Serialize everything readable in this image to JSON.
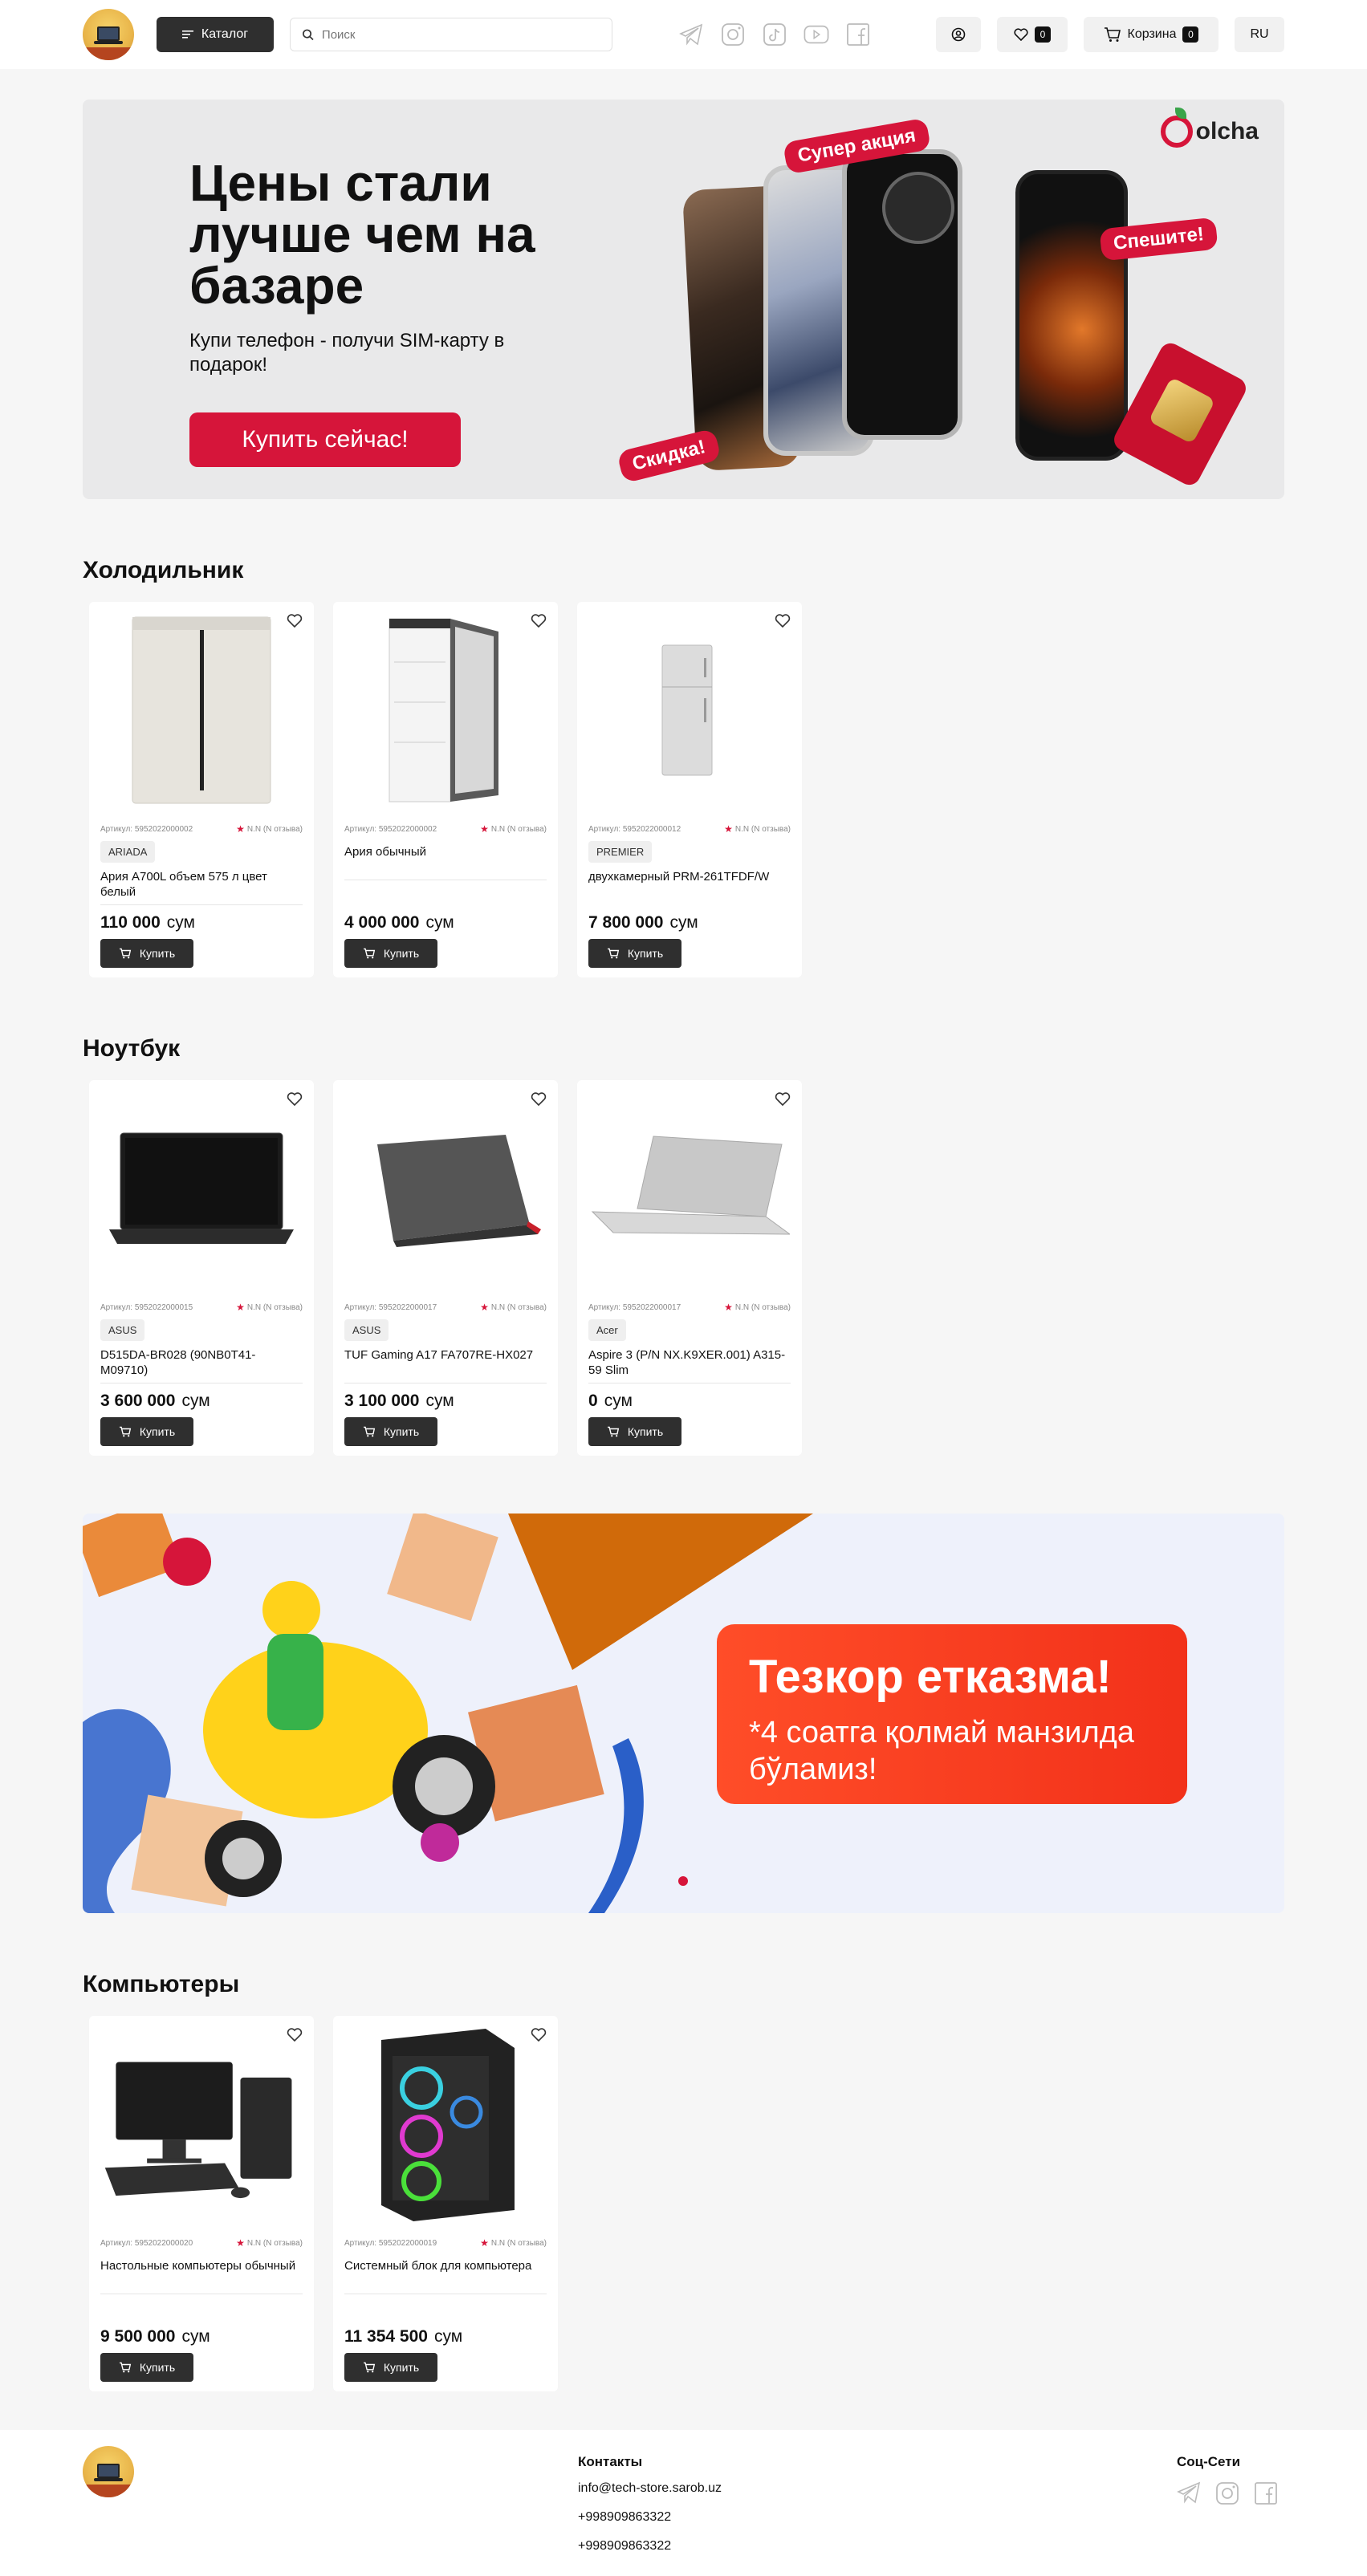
{
  "header": {
    "catalog_label": "Каталог",
    "search_placeholder": "Поиск",
    "wishlist_count": "0",
    "cart_label": "Корзина",
    "cart_count": "0",
    "language": "RU",
    "social_icons": [
      "telegram-icon",
      "instagram-icon",
      "tiktok-icon",
      "youtube-icon",
      "facebook-icon"
    ]
  },
  "banner1": {
    "title": "Цены стали лучше чем на базаре",
    "subtitle": "Купи телефон - получи SIM-карту в подарок!",
    "button": "Купить сейчас!",
    "brand": "olcha",
    "tag_super": "Супер акция",
    "tag_hurry": "Спешите!",
    "tag_discount": "Скидка!",
    "accent": "#d6153a"
  },
  "sections": [
    {
      "title": "Холодильник",
      "products": [
        {
          "sku": "Артикул: 5952022000002",
          "rating": "N.N (N отзыва)",
          "brand": "ARIADA",
          "name": "Ария A700L объем 575 л цвет белый",
          "price": "110 000",
          "currency": "сум",
          "buy": "Купить",
          "image": "fridge-double-icon"
        },
        {
          "sku": "Артикул: 5952022000002",
          "rating": "N.N (N отзыва)",
          "brand": "",
          "name": "Ария обычный",
          "price": "4 000 000",
          "currency": "сум",
          "buy": "Купить",
          "image": "fridge-open-icon"
        },
        {
          "sku": "Артикул: 5952022000012",
          "rating": "N.N (N отзыва)",
          "brand": "PREMIER",
          "name": "двухкамерный PRM-261TFDF/W",
          "price": "7 800 000",
          "currency": "сум",
          "buy": "Купить",
          "image": "fridge-small-icon"
        }
      ]
    },
    {
      "title": "Ноутбук",
      "products": [
        {
          "sku": "Артикул: 5952022000015",
          "rating": "N.N (N отзыва)",
          "brand": "ASUS",
          "name": "D515DA-BR028 (90NB0T41-M09710)",
          "price": "3 600 000",
          "currency": "сум",
          "buy": "Купить",
          "image": "laptop-black-icon"
        },
        {
          "sku": "Артикул: 5952022000017",
          "rating": "N.N (N отзыва)",
          "brand": "ASUS",
          "name": "TUF Gaming A17 FA707RE-HX027",
          "price": "3 100 000",
          "currency": "сум",
          "buy": "Купить",
          "image": "laptop-gaming-icon"
        },
        {
          "sku": "Артикул: 5952022000017",
          "rating": "N.N (N отзыва)",
          "brand": "Acer",
          "name": "Aspire 3 (P/N NX.K9XER.001) A315-59 Slim",
          "price": "0",
          "currency": "сум",
          "buy": "Купить",
          "image": "laptop-silver-icon"
        }
      ]
    }
  ],
  "banner2": {
    "title": "Тезкор етказма!",
    "subtitle": "*4 соатга қолмай манзилда бўламиз!"
  },
  "section3": {
    "title": "Компьютеры",
    "products": [
      {
        "sku": "Артикул: 5952022000020",
        "rating": "N.N (N отзыва)",
        "brand": "",
        "name": "Настольные компьютеры обычный",
        "price": "9 500 000",
        "currency": "сум",
        "buy": "Купить",
        "image": "desktop-set-icon"
      },
      {
        "sku": "Артикул: 5952022000019",
        "rating": "N.N (N отзыва)",
        "brand": "",
        "name": "Системный блок для компьютера",
        "price": "11 354 500",
        "currency": "сум",
        "buy": "Купить",
        "image": "pc-case-icon"
      }
    ]
  },
  "footer": {
    "contacts_title": "Контакты",
    "email": "info@tech-store.sarob.uz",
    "phone1": "+998909863322",
    "phone2": "+998909863322",
    "social_title": "Соц-Сети"
  }
}
